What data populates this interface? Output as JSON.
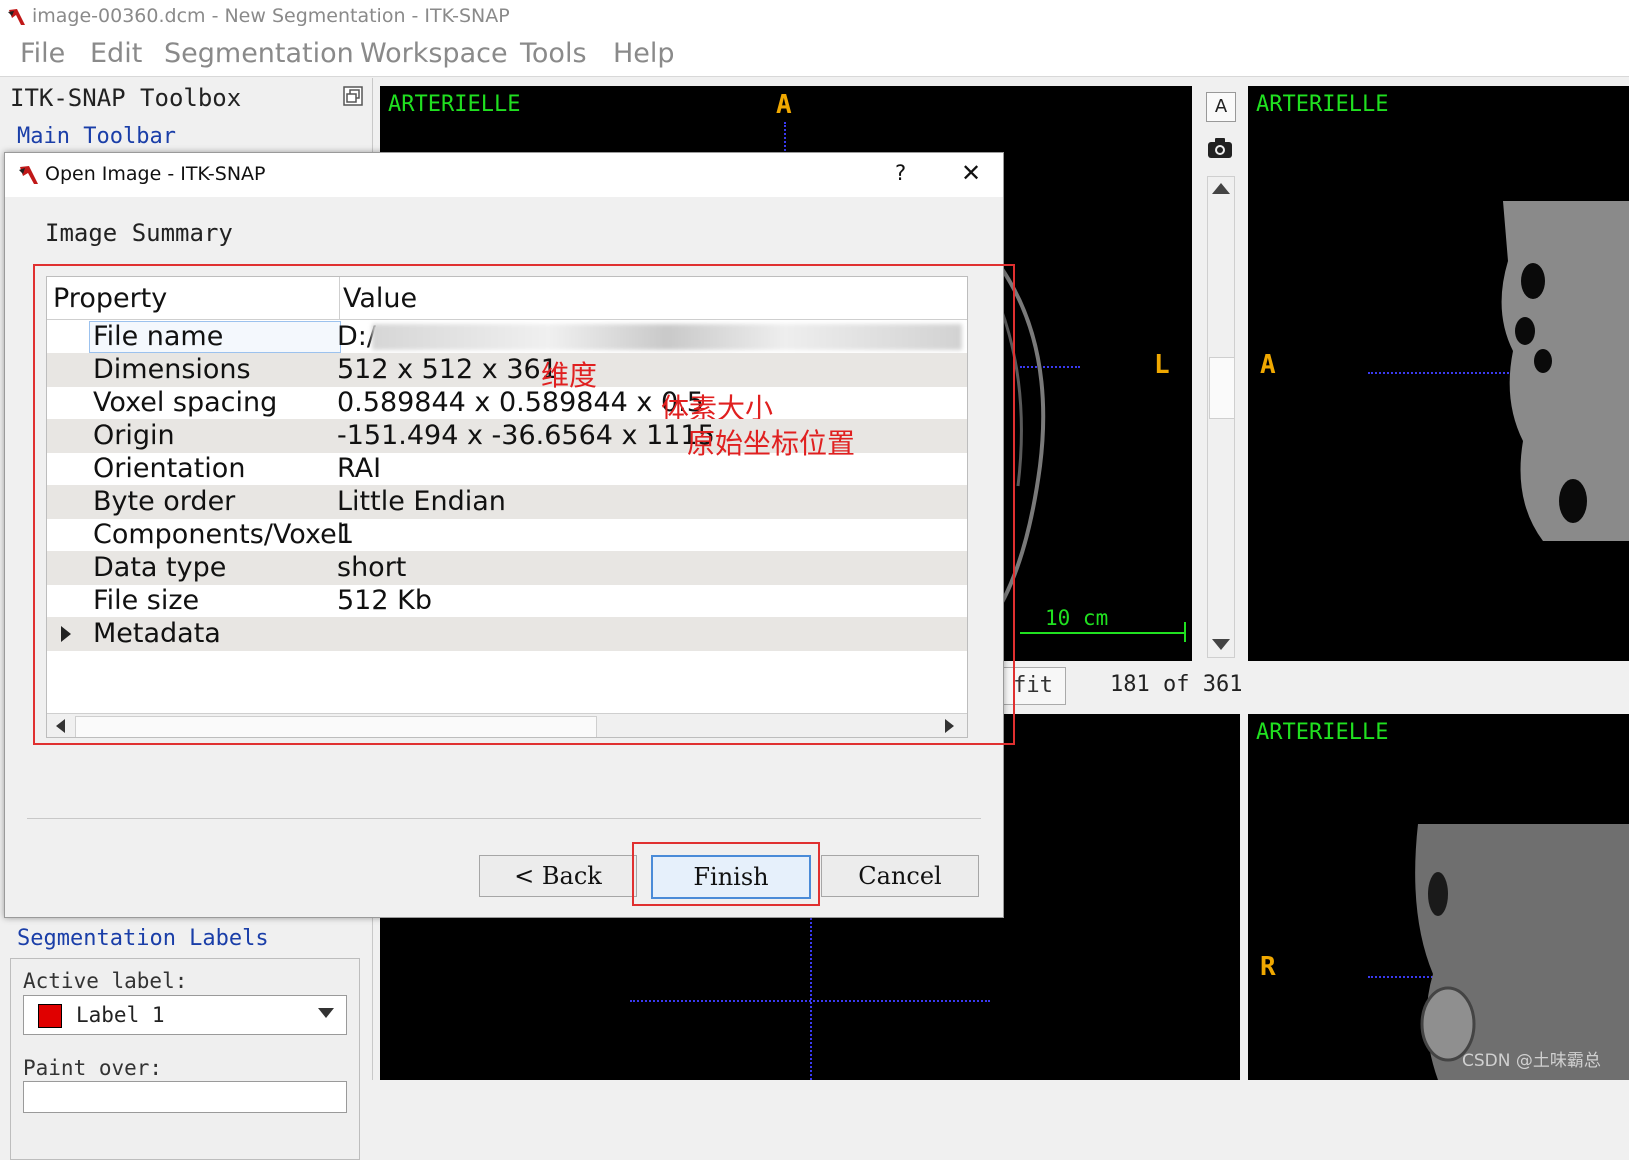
{
  "window": {
    "title": "image-00360.dcm - New Segmentation - ITK-SNAP"
  },
  "menu": [
    "File",
    "Edit",
    "Segmentation",
    "Workspace",
    "Tools",
    "Help"
  ],
  "toolbox": {
    "title": "ITK-SNAP Toolbox",
    "main_toolbar": "Main Toolbar",
    "seg_labels": "Segmentation Labels",
    "active_label_caption": "Active label:",
    "active_label_value": "Label 1",
    "active_label_color": "#e00000",
    "paint_over_caption": "Paint over:"
  },
  "viewports": {
    "axial": {
      "label": "ARTERIELLE",
      "top_marker": "A",
      "right_marker": "L",
      "scale": "10 cm"
    },
    "sagittal": {
      "label": "ARTERIELLE",
      "left_marker": "A"
    },
    "coronal2": {
      "label": "ARTERIELLE",
      "left_marker": "R"
    },
    "zoom_fit": "fit",
    "slice_counter": "181 of 361"
  },
  "dialog": {
    "title": "Open Image - ITK-SNAP",
    "help": "?",
    "close": "✕",
    "heading": "Image Summary",
    "columns": [
      "Property",
      "Value"
    ],
    "rows": [
      {
        "property": "File name",
        "value": "D:/"
      },
      {
        "property": "Dimensions",
        "value": "512 x 512 x 361",
        "note": "维度"
      },
      {
        "property": "Voxel spacing",
        "value": "0.589844 x 0.589844 x 0.5",
        "note": "体素大小"
      },
      {
        "property": "Origin",
        "value": "-151.494 x -36.6564 x 1115",
        "note": "原始坐标位置"
      },
      {
        "property": "Orientation",
        "value": "RAI"
      },
      {
        "property": "Byte order",
        "value": "Little Endian"
      },
      {
        "property": "Components/Voxel",
        "value": "1"
      },
      {
        "property": "Data type",
        "value": "short"
      },
      {
        "property": "File size",
        "value": "512 Kb"
      },
      {
        "property": "Metadata",
        "value": ""
      }
    ],
    "buttons": {
      "back": "< Back",
      "finish": "Finish",
      "cancel": "Cancel"
    }
  },
  "watermark": "CSDN @土味霸总",
  "colors": {
    "annotation": "#e03030",
    "overlay_label": "#20e020",
    "orientation_marker": "#f0a800",
    "crosshair": "#3a3af0"
  }
}
